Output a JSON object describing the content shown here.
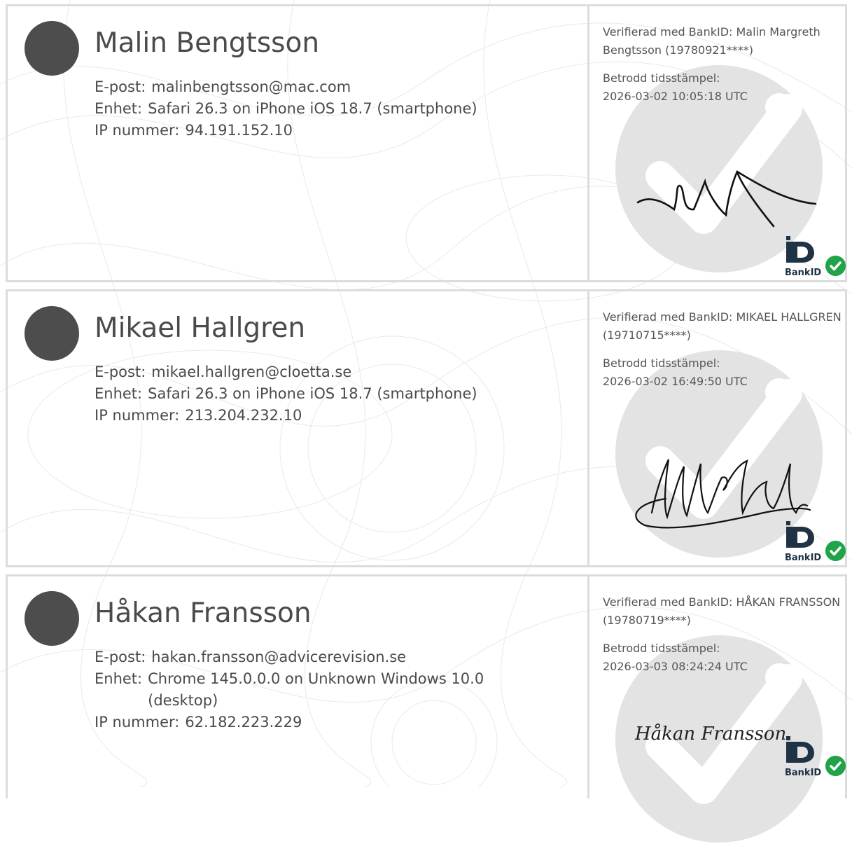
{
  "labels": {
    "email": "E-post:",
    "device": "Enhet:",
    "ip": "IP nummer:",
    "trusted_timestamp": "Betrodd tidsstämpel:",
    "bankid_brand": "BankID"
  },
  "signers": [
    {
      "name": "Malin Bengtsson",
      "email": "malinbengtsson@mac.com",
      "device": "Safari 26.3 on iPhone iOS 18.7 (smartphone)",
      "ip": "94.191.152.10",
      "verification": "Verifierad med BankID: Malin Margreth Bengtsson (19780921****)",
      "timestamp": "2026-03-02 10:05:18 UTC"
    },
    {
      "name": "Mikael Hallgren",
      "email": "mikael.hallgren@cloetta.se",
      "device": "Safari 26.3 on iPhone iOS 18.7 (smartphone)",
      "ip": "213.204.232.10",
      "verification": "Verifierad med BankID: MIKAEL HALLGREN (19710715****)",
      "timestamp": "2026-03-02 16:49:50 UTC"
    },
    {
      "name": "Håkan Fransson",
      "email": "hakan.fransson@advicerevision.se",
      "device": "Chrome 145.0.0.0 on Unknown Windows 10.0 (desktop)",
      "ip": "62.182.223.229",
      "verification": "Verifierad med BankID: HÅKAN FRANSSON (19780719****)",
      "timestamp": "2026-03-03 08:24:24 UTC",
      "signature_text": "Håkan Fransson"
    }
  ],
  "colors": {
    "border": "#dcdcdc",
    "avatar": "#4d4d4d",
    "seal": "#e3e3e3",
    "check": "#21a349",
    "bankid_navy": "#1f3345"
  }
}
